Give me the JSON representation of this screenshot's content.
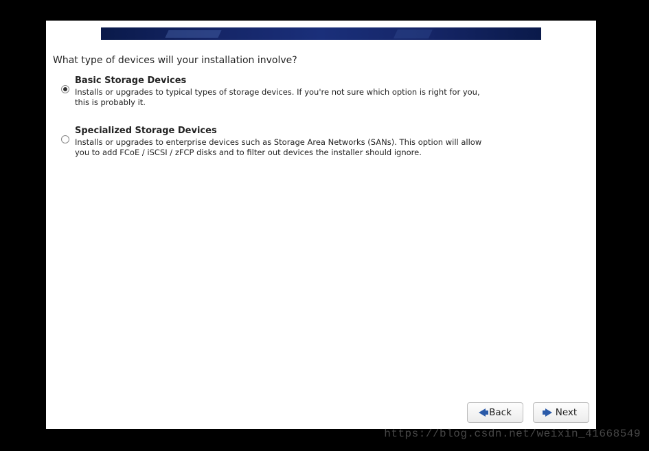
{
  "banner": {},
  "question": "What type of devices will your installation involve?",
  "options": [
    {
      "title": "Basic Storage Devices",
      "desc": "Installs or upgrades to typical types of storage devices.  If you're not sure which option is right for you, this is probably it.",
      "selected": true
    },
    {
      "title": "Specialized Storage Devices",
      "desc": "Installs or upgrades to enterprise devices such as Storage Area Networks (SANs). This option will allow you to add FCoE / iSCSI / zFCP disks and to filter out devices the installer should ignore.",
      "selected": false
    }
  ],
  "footer": {
    "back": "Back",
    "next": "Next"
  },
  "watermark": "https://blog.csdn.net/weixin_41668549"
}
